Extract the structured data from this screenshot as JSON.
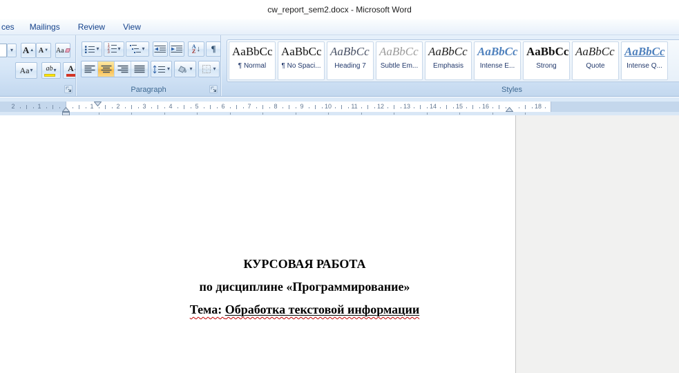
{
  "window": {
    "title": "cw_report_sem2.docx  -  Microsoft Word"
  },
  "ribbon": {
    "tabs": [
      {
        "label": "ces"
      },
      {
        "label": "Mailings"
      },
      {
        "label": "Review"
      },
      {
        "label": "View"
      }
    ],
    "font_group": {
      "icons": {
        "grow_font": "A",
        "shrink_font": "A",
        "clear_formatting": "Aa",
        "change_case": "Aa",
        "highlight": "ab",
        "font_color": "A"
      }
    },
    "paragraph_group": {
      "label": "Paragraph",
      "icons": {
        "pilcrow": "¶",
        "sort_a": "A",
        "sort_z": "Z",
        "sort_arrow": "↓",
        "num1": "1",
        "num2": "2",
        "num3": "3",
        "dropdown": "▾",
        "caret_up": "▲",
        "caret_down": "▼"
      }
    },
    "styles_group": {
      "label": "Styles",
      "items": [
        {
          "name": "normal",
          "label": "¶ Normal",
          "sample": "AaBbCc",
          "style_class": ""
        },
        {
          "name": "no-spacing",
          "label": "¶ No Spaci...",
          "sample": "AaBbCc",
          "style_class": ""
        },
        {
          "name": "heading-7",
          "label": "Heading 7",
          "sample": "AaBbCc",
          "style_class": "st-heading7"
        },
        {
          "name": "subtle-emphasis",
          "label": "Subtle Em...",
          "sample": "AaBbCc",
          "style_class": "st-subtle"
        },
        {
          "name": "emphasis",
          "label": "Emphasis",
          "sample": "AaBbCc",
          "style_class": "st-emphasis"
        },
        {
          "name": "intense-emphasis",
          "label": "Intense E...",
          "sample": "AaBbCc",
          "style_class": "st-intense-e"
        },
        {
          "name": "strong",
          "label": "Strong",
          "sample": "AaBbCc",
          "style_class": "st-strong"
        },
        {
          "name": "quote",
          "label": "Quote",
          "sample": "AaBbCc",
          "style_class": "st-quote"
        },
        {
          "name": "intense-quote",
          "label": "Intense Q...",
          "sample": "AaBbCc",
          "style_class": "st-intense-q"
        }
      ]
    }
  },
  "ruler": {
    "margin_numbers": [
      "2",
      "1"
    ],
    "numbers": [
      "1",
      "2",
      "3",
      "4",
      "5",
      "6",
      "7",
      "8",
      "9",
      "10",
      "11",
      "12",
      "13",
      "14",
      "15",
      "16"
    ],
    "right_number": "18"
  },
  "document": {
    "line1": "КУРСОВАЯ РАБОТА",
    "line2": "по дисциплине «Программирование»",
    "line3_prefix": "Тема: ",
    "line3_underlined": "Обработка текстовой информации"
  }
}
